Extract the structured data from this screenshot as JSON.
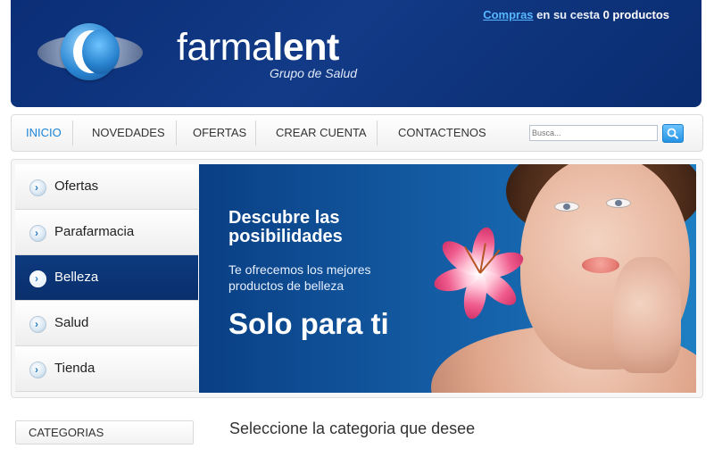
{
  "header": {
    "cart_link": "Compras",
    "cart_text": " en su cesta ",
    "cart_count": "0 productos",
    "brand_light": "farma",
    "brand_bold": "lent",
    "tagline": "Grupo de Salud"
  },
  "nav": {
    "items": [
      "INICIO",
      "NOVEDADES",
      "OFERTAS",
      "CREAR CUENTA",
      "CONTACTENOS"
    ],
    "active": "INICIO",
    "search_placeholder": "Busca..."
  },
  "menu": {
    "items": [
      "Ofertas",
      "Parafarmacia",
      "Belleza",
      "Salud",
      "Tienda"
    ],
    "active": "Belleza"
  },
  "banner": {
    "title": "Descubre las posibilidades",
    "subtitle": "Te ofrecemos los mejores productos de belleza",
    "headline": "Solo para ti"
  },
  "categories": {
    "label": "CATEGORIAS"
  },
  "main": {
    "title": "Seleccione la categoria que desee"
  },
  "colors": {
    "header_blue": "#0b2e77",
    "accent_blue": "#1c84d6",
    "active_menu": "#0c3a7f"
  }
}
